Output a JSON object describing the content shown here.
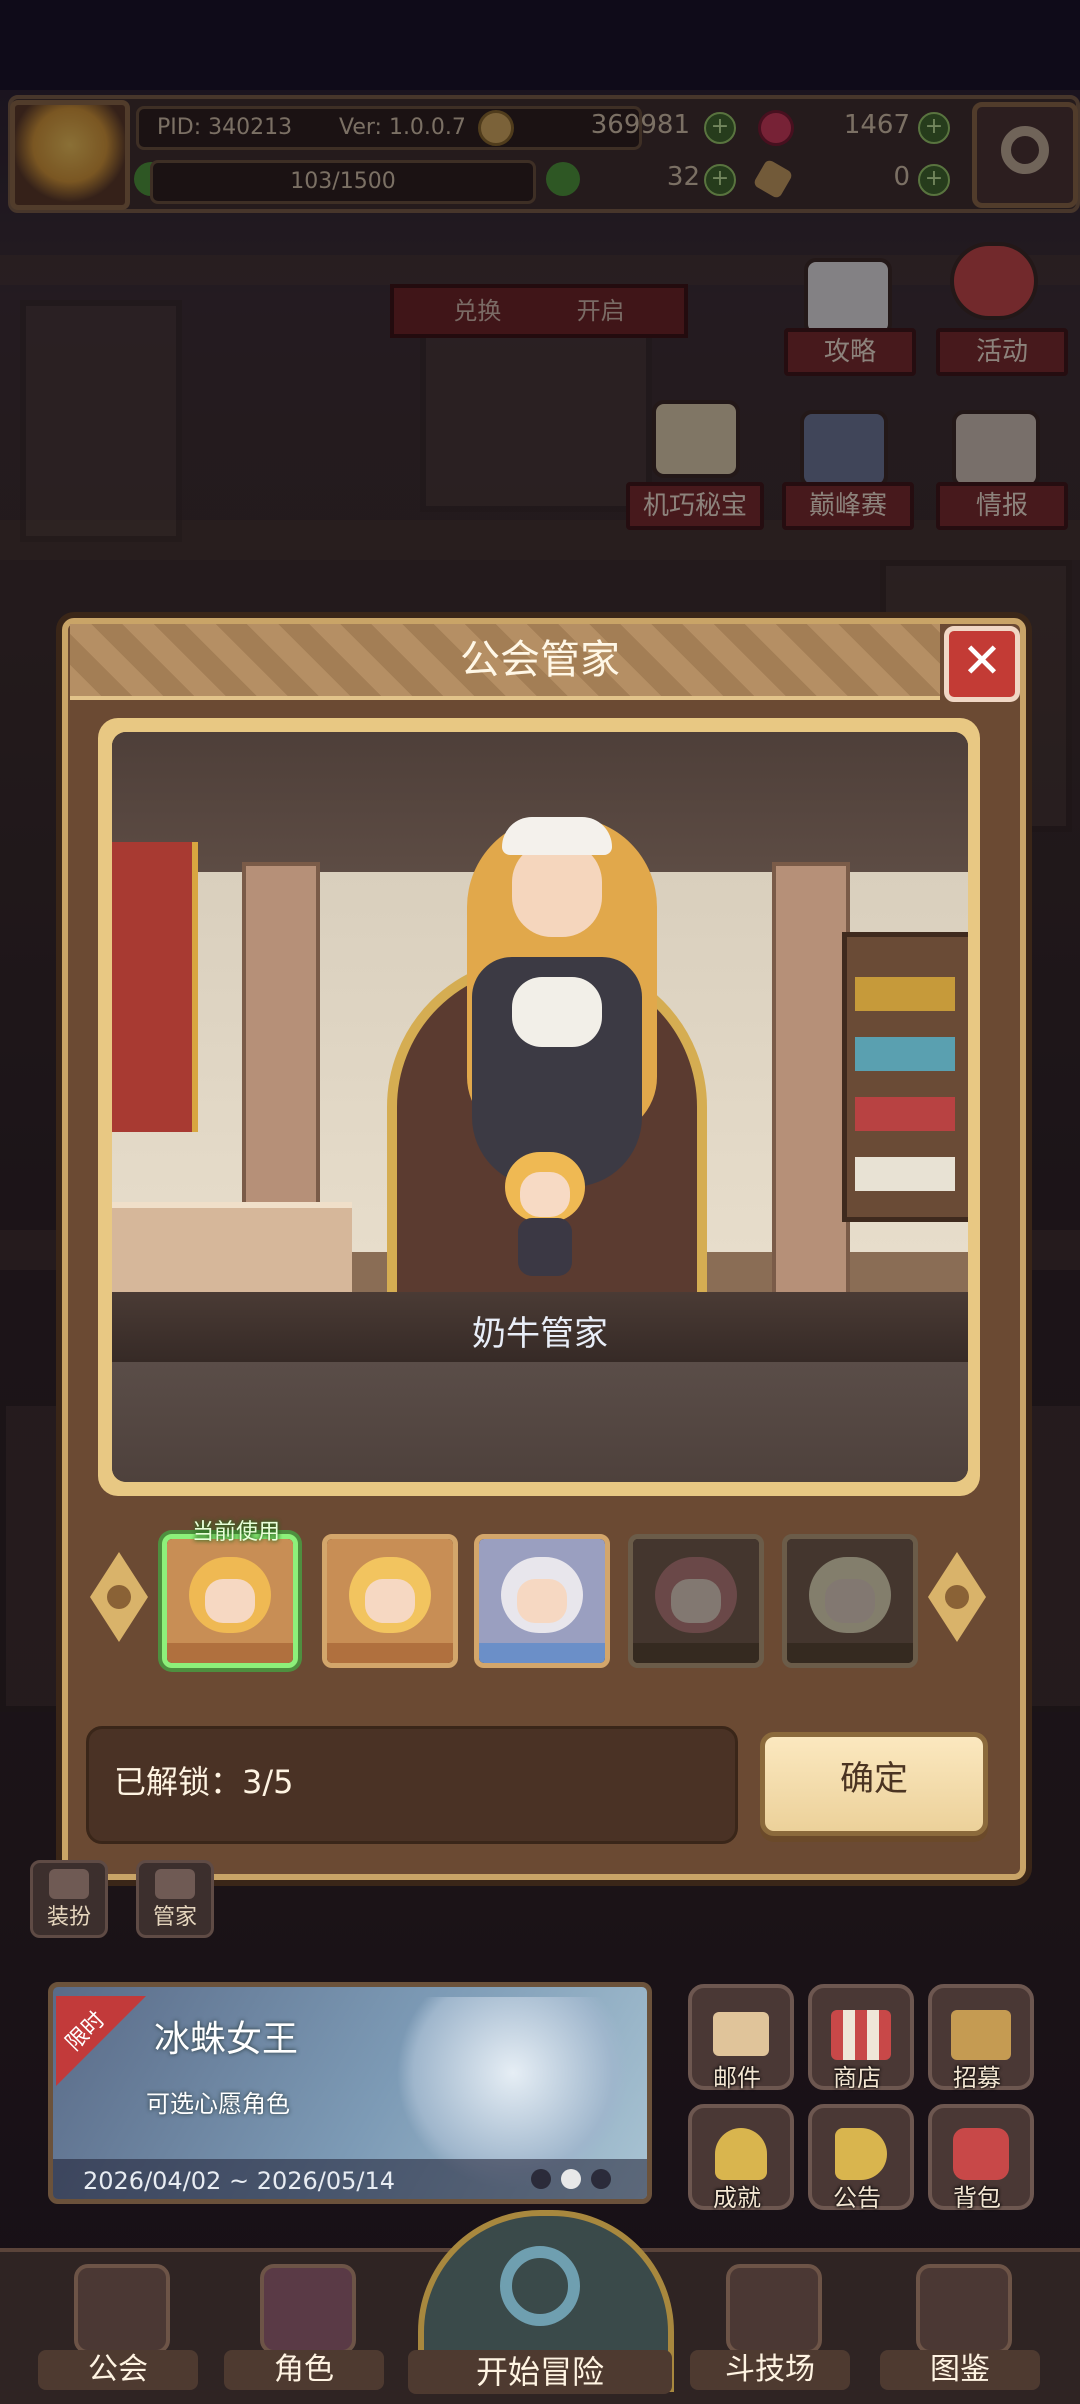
{
  "hud": {
    "pid": "PID: 340213",
    "version": "Ver: 1.0.0.7",
    "gold": "369981",
    "gems": "1467",
    "energy": "103/1500",
    "clover": "32",
    "tickets": "0"
  },
  "scene_buttons": {
    "exchange_banner": "兑换",
    "exchange_banner_tail": "开启",
    "guide": "攻略",
    "events": "活动",
    "secret": "机巧秘宝",
    "peak": "巅峰赛",
    "intel": "情报"
  },
  "dialog": {
    "title": "公会管家",
    "character_name": "奶牛管家",
    "current_tag": "当前使用",
    "unlock_label": "已解锁：",
    "unlock_value": "3/5",
    "confirm": "确定"
  },
  "thumbnails": [
    {
      "name": "cow-maid-thumb",
      "hair": "#efb953",
      "bg": "#c88e55",
      "base": "#b0703e",
      "state": "current"
    },
    {
      "name": "blonde-maid-thumb",
      "hair": "#f2c45f",
      "bg": "#c88e55",
      "base": "#b0703e",
      "state": "unlocked"
    },
    {
      "name": "white-hair-thumb",
      "hair": "#e8e6ec",
      "bg": "#9a9fc0",
      "base": "#6b8fc8",
      "state": "unlocked"
    },
    {
      "name": "pink-hair-thumb",
      "hair": "#e07a7a",
      "bg": "#8a6048",
      "base": "#6b4a2c",
      "state": "locked"
    },
    {
      "name": "pale-hair-thumb",
      "hair": "#f4e6b0",
      "bg": "#8a6048",
      "base": "#6b4a2c",
      "state": "locked"
    }
  ],
  "side_buttons": {
    "outfit": "装扮",
    "butler": "管家"
  },
  "event": {
    "tag": "限时",
    "title": "冰蛛女王",
    "subtitle": "可选心愿角色",
    "dates": "2026/04/02 ~ 2026/05/14"
  },
  "grid": {
    "mail": "邮件",
    "shop": "商店",
    "recruit": "招募",
    "achievement": "成就",
    "notice": "公告",
    "bag": "背包"
  },
  "nav": {
    "guild": "公会",
    "character": "角色",
    "adventure": "开始冒险",
    "arena": "斗技场",
    "codex": "图鉴"
  },
  "colors": {
    "accent_gold": "#c9a467",
    "confirm_bg": "#f3dcaa",
    "current_border": "#8df07a",
    "close_red": "#c33b35"
  }
}
